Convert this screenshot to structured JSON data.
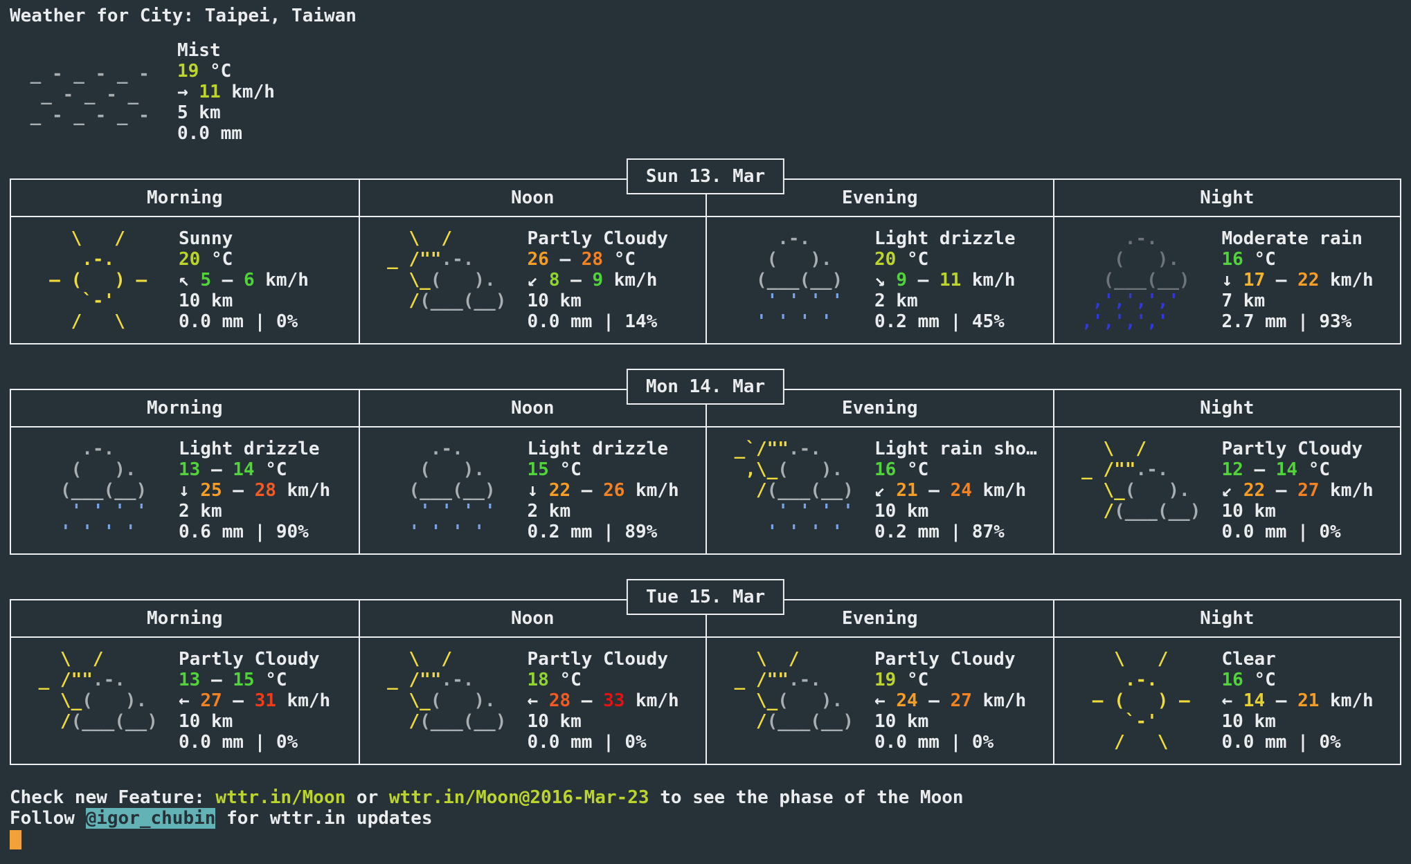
{
  "title": "Weather for City: Taipei, Taiwan",
  "periods": [
    "Morning",
    "Noon",
    "Evening",
    "Night"
  ],
  "palette": {
    "bg": "#263138",
    "fg": "#eaeced",
    "border": "#eef0f1",
    "g": "#50d43a",
    "g2": "#90d52f",
    "yg": "#bcd52b",
    "y": "#e6cf2e",
    "yo": "#f6b42c",
    "o1": "#f89d23",
    "o2": "#f58220",
    "ro": "#f45a22",
    "r1": "#f23b1b",
    "r2": "#e51212",
    "sun": "#efdb3d",
    "cloud": "#a9aeb1",
    "dcloud": "#6e7477",
    "mist": "#a9aeb1",
    "rl": "#7aa3e6",
    "rb": "#3138df",
    "hlbg": "#62b2b6",
    "cursor": "#f2a238"
  },
  "arts": {
    "fog": [
      [
        [
          " _ - _ - _ - ",
          "mist"
        ]
      ],
      [
        [
          "  _ - _ - _  ",
          "mist"
        ]
      ],
      [
        [
          " _ - _ - _ - ",
          "mist"
        ]
      ]
    ],
    "sunny": [
      [
        [
          "    \\   /    ",
          "sun"
        ]
      ],
      [
        [
          "     .-.     ",
          "sun"
        ]
      ],
      [
        [
          "  — (   ) —  ",
          "sun"
        ]
      ],
      [
        [
          "     `-'     ",
          "sun"
        ]
      ],
      [
        [
          "    /   \\    ",
          "sun"
        ]
      ]
    ],
    "partly_cloudy": [
      [
        [
          "   \\  /      ",
          "sun"
        ]
      ],
      [
        [
          " _ /\"\"",
          "sun"
        ],
        [
          ".-.    ",
          "cloud"
        ]
      ],
      [
        [
          "   \\_",
          "sun"
        ],
        [
          "(   ).  ",
          "cloud"
        ]
      ],
      [
        [
          "   /",
          "sun"
        ],
        [
          "(___(__) ",
          "cloud"
        ]
      ]
    ],
    "light_rain": [
      [
        [
          "     .-.     ",
          "cloud"
        ]
      ],
      [
        [
          "    (   ).   ",
          "cloud"
        ]
      ],
      [
        [
          "   (___(__)  ",
          "cloud"
        ]
      ],
      [
        [
          "    ' ' ' '  ",
          "rl"
        ]
      ],
      [
        [
          "   ' ' ' '   ",
          "rl"
        ]
      ]
    ],
    "heavy_rain": [
      [
        [
          "     .-.     ",
          "dcloud"
        ]
      ],
      [
        [
          "    (   ).   ",
          "dcloud"
        ]
      ],
      [
        [
          "   (___(__)  ",
          "dcloud"
        ]
      ],
      [
        [
          "  ‚'‚'‚'‚'   ",
          "rb"
        ]
      ],
      [
        [
          " ‚'‚'‚'‚'    ",
          "rb"
        ]
      ]
    ],
    "shower": [
      [
        [
          " _`/\"\"",
          "sun"
        ],
        [
          ".-.    ",
          "cloud"
        ]
      ],
      [
        [
          "  ,\\_",
          "sun"
        ],
        [
          "(   ).  ",
          "cloud"
        ]
      ],
      [
        [
          "   /",
          "sun"
        ],
        [
          "(___(__) ",
          "cloud"
        ]
      ],
      [
        [
          "     ' ' ' ' ",
          "rl"
        ]
      ],
      [
        [
          "    ' ' ' '  ",
          "rl"
        ]
      ]
    ]
  },
  "current": {
    "condition": "Mist",
    "art": "fog",
    "text": [
      [
        [
          "Mist",
          null
        ]
      ],
      [
        [
          "19",
          "yg"
        ],
        [
          " °C",
          null
        ]
      ],
      [
        [
          "→ ",
          null
        ],
        [
          "11",
          "yg"
        ],
        [
          " km/h",
          null
        ]
      ],
      [
        [
          "5 km",
          null
        ]
      ],
      [
        [
          "0.0 mm",
          null
        ]
      ]
    ]
  },
  "days": [
    {
      "date": "Sun 13. Mar",
      "cells": [
        {
          "condition": "Sunny",
          "art": "sunny",
          "text": [
            [
              [
                "Sunny",
                null
              ]
            ],
            [
              [
                "20",
                "yg"
              ],
              [
                " °C",
                null
              ]
            ],
            [
              [
                "↖ ",
                null
              ],
              [
                "5",
                "g"
              ],
              [
                " — ",
                null
              ],
              [
                "6",
                "g"
              ],
              [
                " km/h",
                null
              ]
            ],
            [
              [
                "10 km",
                null
              ]
            ],
            [
              [
                "0.0 mm | 0%",
                null
              ]
            ]
          ]
        },
        {
          "condition": "Partly Cloudy",
          "art": "partly_cloudy",
          "text": [
            [
              [
                "Partly Cloudy",
                null
              ]
            ],
            [
              [
                "26",
                "o1"
              ],
              [
                " — ",
                null
              ],
              [
                "28",
                "o2"
              ],
              [
                " °C",
                null
              ]
            ],
            [
              [
                "↙ ",
                null
              ],
              [
                "8",
                "g2"
              ],
              [
                " — ",
                null
              ],
              [
                "9",
                "g"
              ],
              [
                " km/h",
                null
              ]
            ],
            [
              [
                "10 km",
                null
              ]
            ],
            [
              [
                "0.0 mm | 14%",
                null
              ]
            ]
          ]
        },
        {
          "condition": "Light drizzle",
          "art": "light_rain",
          "text": [
            [
              [
                "Light drizzle",
                null
              ]
            ],
            [
              [
                "20",
                "yg"
              ],
              [
                " °C",
                null
              ]
            ],
            [
              [
                "↘ ",
                null
              ],
              [
                "9",
                "g"
              ],
              [
                " — ",
                null
              ],
              [
                "11",
                "yg"
              ],
              [
                " km/h",
                null
              ]
            ],
            [
              [
                "2 km",
                null
              ]
            ],
            [
              [
                "0.2 mm | 45%",
                null
              ]
            ]
          ]
        },
        {
          "condition": "Moderate rain",
          "art": "heavy_rain",
          "text": [
            [
              [
                "Moderate rain",
                null
              ]
            ],
            [
              [
                "16",
                "g"
              ],
              [
                " °C",
                null
              ]
            ],
            [
              [
                "↓ ",
                null
              ],
              [
                "17",
                "yo"
              ],
              [
                " — ",
                null
              ],
              [
                "22",
                "o1"
              ],
              [
                " km/h",
                null
              ]
            ],
            [
              [
                "7 km",
                null
              ]
            ],
            [
              [
                "2.7 mm | 93%",
                null
              ]
            ]
          ]
        }
      ]
    },
    {
      "date": "Mon 14. Mar",
      "cells": [
        {
          "condition": "Light drizzle",
          "art": "light_rain",
          "text": [
            [
              [
                "Light drizzle",
                null
              ]
            ],
            [
              [
                "13",
                "g"
              ],
              [
                " — ",
                null
              ],
              [
                "14",
                "g"
              ],
              [
                " °C",
                null
              ]
            ],
            [
              [
                "↓ ",
                null
              ],
              [
                "25",
                "o1"
              ],
              [
                " — ",
                null
              ],
              [
                "28",
                "ro"
              ],
              [
                " km/h",
                null
              ]
            ],
            [
              [
                "2 km",
                null
              ]
            ],
            [
              [
                "0.6 mm | 90%",
                null
              ]
            ]
          ]
        },
        {
          "condition": "Light drizzle",
          "art": "light_rain",
          "text": [
            [
              [
                "Light drizzle",
                null
              ]
            ],
            [
              [
                "15",
                "g"
              ],
              [
                " °C",
                null
              ]
            ],
            [
              [
                "↓ ",
                null
              ],
              [
                "22",
                "o1"
              ],
              [
                " — ",
                null
              ],
              [
                "26",
                "o2"
              ],
              [
                " km/h",
                null
              ]
            ],
            [
              [
                "2 km",
                null
              ]
            ],
            [
              [
                "0.2 mm | 89%",
                null
              ]
            ]
          ]
        },
        {
          "condition": "Light rain sho…",
          "art": "shower",
          "text": [
            [
              [
                "Light rain sho…",
                null
              ]
            ],
            [
              [
                "16",
                "g"
              ],
              [
                " °C",
                null
              ]
            ],
            [
              [
                "↙ ",
                null
              ],
              [
                "21",
                "o1"
              ],
              [
                " — ",
                null
              ],
              [
                "24",
                "o2"
              ],
              [
                " km/h",
                null
              ]
            ],
            [
              [
                "10 km",
                null
              ]
            ],
            [
              [
                "0.2 mm | 87%",
                null
              ]
            ]
          ]
        },
        {
          "condition": "Partly Cloudy",
          "art": "partly_cloudy",
          "text": [
            [
              [
                "Partly Cloudy",
                null
              ]
            ],
            [
              [
                "12",
                "g"
              ],
              [
                " — ",
                null
              ],
              [
                "14",
                "g"
              ],
              [
                " °C",
                null
              ]
            ],
            [
              [
                "↙ ",
                null
              ],
              [
                "22",
                "o1"
              ],
              [
                " — ",
                null
              ],
              [
                "27",
                "o2"
              ],
              [
                " km/h",
                null
              ]
            ],
            [
              [
                "10 km",
                null
              ]
            ],
            [
              [
                "0.0 mm | 0%",
                null
              ]
            ]
          ]
        }
      ]
    },
    {
      "date": "Tue 15. Mar",
      "cells": [
        {
          "condition": "Partly Cloudy",
          "art": "partly_cloudy",
          "text": [
            [
              [
                "Partly Cloudy",
                null
              ]
            ],
            [
              [
                "13",
                "g"
              ],
              [
                " — ",
                null
              ],
              [
                "15",
                "g"
              ],
              [
                " °C",
                null
              ]
            ],
            [
              [
                "← ",
                null
              ],
              [
                "27",
                "o2"
              ],
              [
                " — ",
                null
              ],
              [
                "31",
                "r1"
              ],
              [
                " km/h",
                null
              ]
            ],
            [
              [
                "10 km",
                null
              ]
            ],
            [
              [
                "0.0 mm | 0%",
                null
              ]
            ]
          ]
        },
        {
          "condition": "Partly Cloudy",
          "art": "partly_cloudy",
          "text": [
            [
              [
                "Partly Cloudy",
                null
              ]
            ],
            [
              [
                "18",
                "g2"
              ],
              [
                " °C",
                null
              ]
            ],
            [
              [
                "← ",
                null
              ],
              [
                "28",
                "ro"
              ],
              [
                " — ",
                null
              ],
              [
                "33",
                "r2"
              ],
              [
                " km/h",
                null
              ]
            ],
            [
              [
                "10 km",
                null
              ]
            ],
            [
              [
                "0.0 mm | 0%",
                null
              ]
            ]
          ]
        },
        {
          "condition": "Partly Cloudy",
          "art": "partly_cloudy",
          "text": [
            [
              [
                "Partly Cloudy",
                null
              ]
            ],
            [
              [
                "19",
                "yg"
              ],
              [
                " °C",
                null
              ]
            ],
            [
              [
                "← ",
                null
              ],
              [
                "24",
                "o1"
              ],
              [
                " — ",
                null
              ],
              [
                "27",
                "o2"
              ],
              [
                " km/h",
                null
              ]
            ],
            [
              [
                "10 km",
                null
              ]
            ],
            [
              [
                "0.0 mm | 0%",
                null
              ]
            ]
          ]
        },
        {
          "condition": "Clear",
          "art": "sunny",
          "text": [
            [
              [
                "Clear",
                null
              ]
            ],
            [
              [
                "16",
                "g"
              ],
              [
                " °C",
                null
              ]
            ],
            [
              [
                "← ",
                null
              ],
              [
                "14",
                "y"
              ],
              [
                " — ",
                null
              ],
              [
                "21",
                "o1"
              ],
              [
                " km/h",
                null
              ]
            ],
            [
              [
                "10 km",
                null
              ]
            ],
            [
              [
                "0.0 mm | 0%",
                null
              ]
            ]
          ]
        }
      ]
    }
  ],
  "footer": {
    "line1": [
      [
        [
          "Check new Feature: ",
          null
        ],
        [
          "wttr.in/Moon",
          "yg"
        ],
        [
          " or ",
          null
        ],
        [
          "wttr.in/Moon@2016-Mar-23",
          "yg"
        ],
        [
          " to see the phase of the Moon",
          null
        ]
      ]
    ],
    "line2": [
      [
        [
          "Follow ",
          null
        ],
        [
          "@igor_chubin",
          "hl"
        ],
        [
          " for wttr.in updates",
          null
        ]
      ]
    ]
  }
}
